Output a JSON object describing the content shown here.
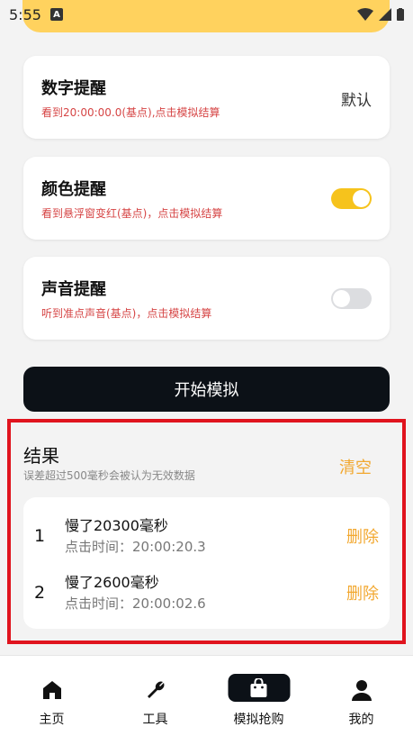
{
  "status": {
    "time": "5:55",
    "badge": "A"
  },
  "cards": [
    {
      "title": "数字提醒",
      "subtitle": "看到20:00:00.0(基点),点击模拟结算",
      "value": "默认"
    },
    {
      "title": "颜色提醒",
      "subtitle": "看到悬浮窗变红(基点)，点击模拟结算",
      "toggle": true
    },
    {
      "title": "声音提醒",
      "subtitle": "听到准点声音(基点)，点击模拟结算",
      "toggle": false
    }
  ],
  "start_button": "开始模拟",
  "results": {
    "title": "结果",
    "subtitle": "误差超过500毫秒会被认为无效数据",
    "clear_label": "清空",
    "rows": [
      {
        "index": "1",
        "main": "慢了20300毫秒",
        "time": "点击时间：20:00:20.3",
        "delete": "删除"
      },
      {
        "index": "2",
        "main": "慢了2600毫秒",
        "time": "点击时间：20:00:02.6",
        "delete": "删除"
      }
    ]
  },
  "nav": [
    {
      "label": "主页",
      "icon": "home-icon"
    },
    {
      "label": "工具",
      "icon": "wrench-icon"
    },
    {
      "label": "模拟抢购",
      "icon": "shopping-bag-icon",
      "active": true
    },
    {
      "label": "我的",
      "icon": "person-icon"
    }
  ],
  "colors": {
    "accent": "#f6c31c",
    "delete": "#f2a830",
    "warning_text": "#d64545",
    "highlight_border": "#e0141e"
  }
}
